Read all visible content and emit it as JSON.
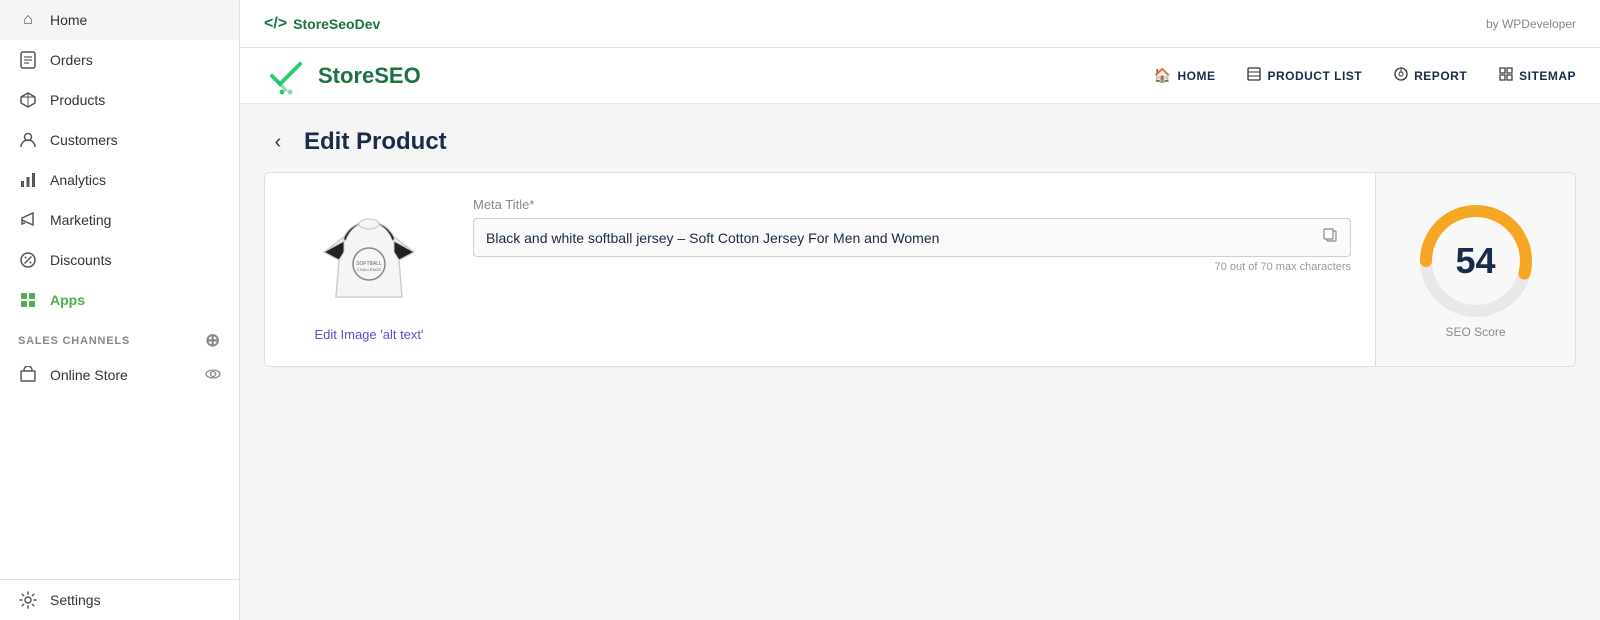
{
  "topbar": {
    "brand": "</> StoreSeoDev",
    "code_symbol": "</>",
    "app_name": "StoreSeoDev",
    "by": "by WPDeveloper"
  },
  "plugin": {
    "title_store": "Store",
    "title_seo": "SEO",
    "nav": [
      {
        "id": "home",
        "label": "HOME",
        "icon": "🏠"
      },
      {
        "id": "product-list",
        "label": "PRODUCT LIST",
        "icon": "☰"
      },
      {
        "id": "report",
        "label": "REPORT",
        "icon": "⚙"
      },
      {
        "id": "sitemap",
        "label": "SITEMAP",
        "icon": "⊞"
      }
    ]
  },
  "sidebar": {
    "items": [
      {
        "id": "home",
        "label": "Home",
        "icon": "⌂"
      },
      {
        "id": "orders",
        "label": "Orders",
        "icon": "📋"
      },
      {
        "id": "products",
        "label": "Products",
        "icon": "🏷"
      },
      {
        "id": "customers",
        "label": "Customers",
        "icon": "👤"
      },
      {
        "id": "analytics",
        "label": "Analytics",
        "icon": "📊"
      },
      {
        "id": "marketing",
        "label": "Marketing",
        "icon": "📣"
      },
      {
        "id": "discounts",
        "label": "Discounts",
        "icon": "🏷"
      },
      {
        "id": "apps",
        "label": "Apps",
        "icon": "⊞",
        "active": true
      }
    ],
    "sales_channels_label": "SALES CHANNELS",
    "online_store_label": "Online Store",
    "settings_label": "Settings"
  },
  "page": {
    "back_label": "‹",
    "title": "Edit Product"
  },
  "product": {
    "edit_alt_text": "Edit Image 'alt text'",
    "meta_title_label": "Meta Title*",
    "meta_title_value": "Black and white softball jersey – Soft Cotton Jersey For Men and Women",
    "meta_title_hint": "70 out of 70 max characters"
  },
  "seo": {
    "score": "54",
    "label": "SEO Score"
  }
}
